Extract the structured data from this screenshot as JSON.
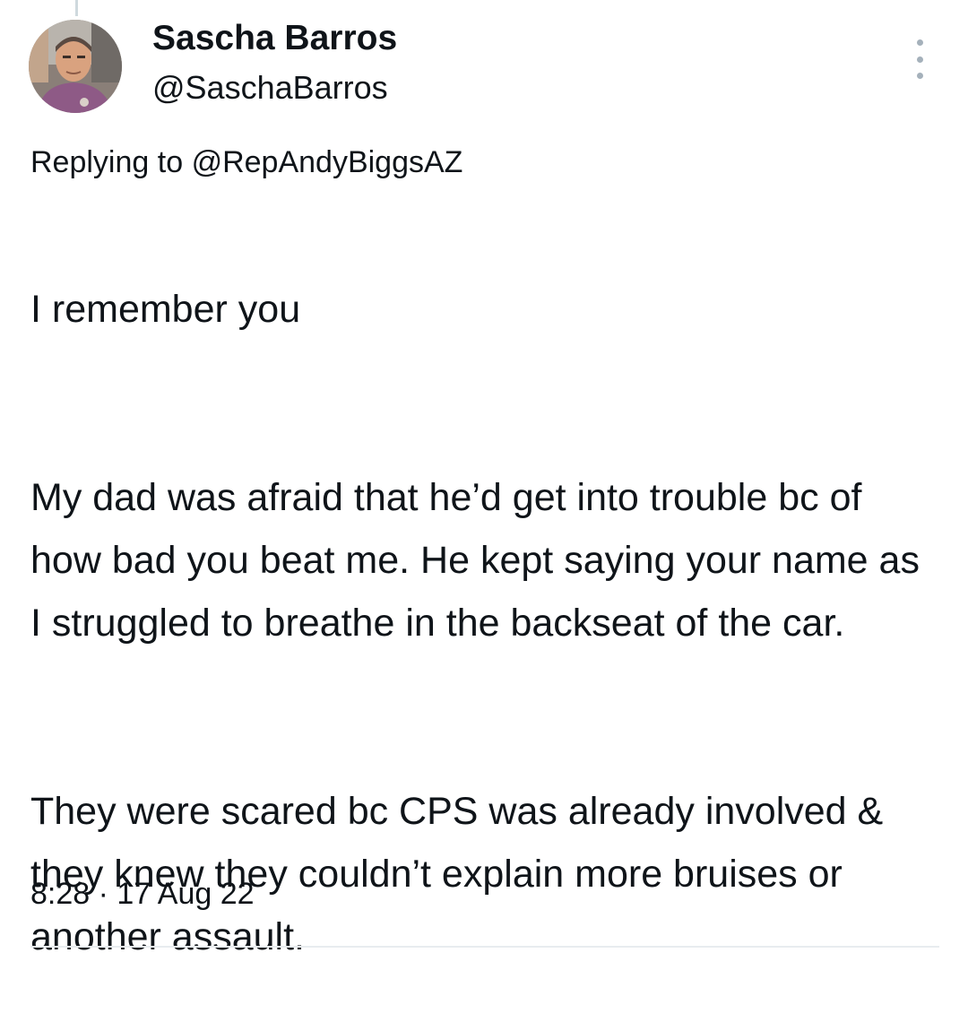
{
  "tweet": {
    "author": {
      "display_name": "Sascha Barros",
      "handle": "@SaschaBarros",
      "avatar": "profile-photo"
    },
    "menu_icon": "more-vertical-icon",
    "reply": {
      "prefix": "Replying to",
      "mention": "@RepAndyBiggsAZ"
    },
    "paragraphs": [
      "I remember you",
      "My dad was afraid that he’d get into trouble bc of how bad you beat me. He kept saying your name as I struggled to breathe in the backseat of the car.",
      "They were scared bc CPS was already involved & they knew they couldn’t explain more bruises or another assault."
    ],
    "timestamp": "8:28 · 17 Aug 22"
  }
}
